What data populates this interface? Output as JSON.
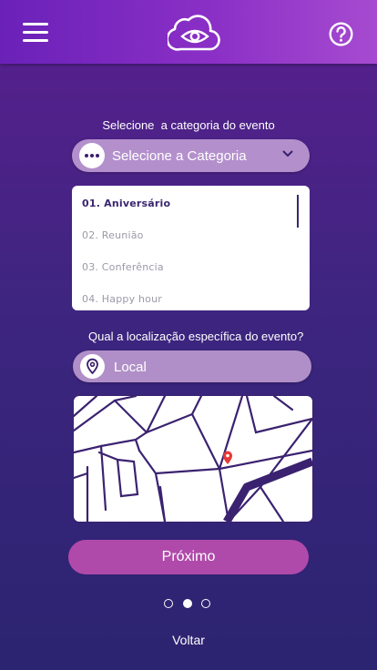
{
  "header": {
    "menu_icon": "hamburger-menu-icon",
    "logo_icon": "cloud-eye-logo-icon",
    "help_icon": "question-circle-icon"
  },
  "category": {
    "prompt": "Selecione  a categoria do evento",
    "select_placeholder": "Selecione a Categoria",
    "options": [
      {
        "label": "01. Aniversário",
        "selected": true
      },
      {
        "label": "02. Reunião",
        "selected": false
      },
      {
        "label": "03. Conferência",
        "selected": false
      },
      {
        "label": "04. Happy hour",
        "selected": false
      }
    ]
  },
  "location": {
    "prompt": "Qual a localização específica do evento?",
    "field_value": "Local"
  },
  "actions": {
    "next_label": "Próximo",
    "back_label": "Voltar"
  },
  "pagination": {
    "total": 3,
    "current": 2
  },
  "colors": {
    "accent": "#b04aaa",
    "header": "#7a28c0",
    "map_pin": "#e53935"
  }
}
